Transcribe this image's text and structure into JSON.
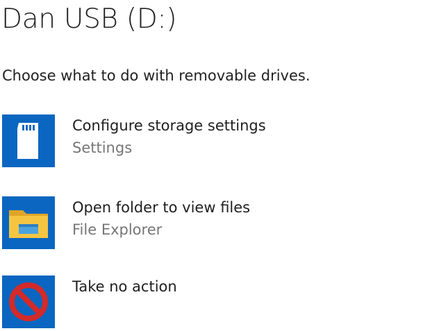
{
  "dialog": {
    "title": "Dan USB (D:)",
    "prompt": "Choose what to do with removable drives."
  },
  "options": [
    {
      "label": "Configure storage settings",
      "sublabel": "Settings",
      "icon": "sd-card-icon"
    },
    {
      "label": "Open folder to view files",
      "sublabel": "File Explorer",
      "icon": "folder-icon"
    },
    {
      "label": "Take no action",
      "icon": "no-action-icon"
    }
  ],
  "colors": {
    "tile_blue": "#0a66c0",
    "folder_yellow": "#f5c542",
    "no_action_red": "#d32a2a"
  }
}
